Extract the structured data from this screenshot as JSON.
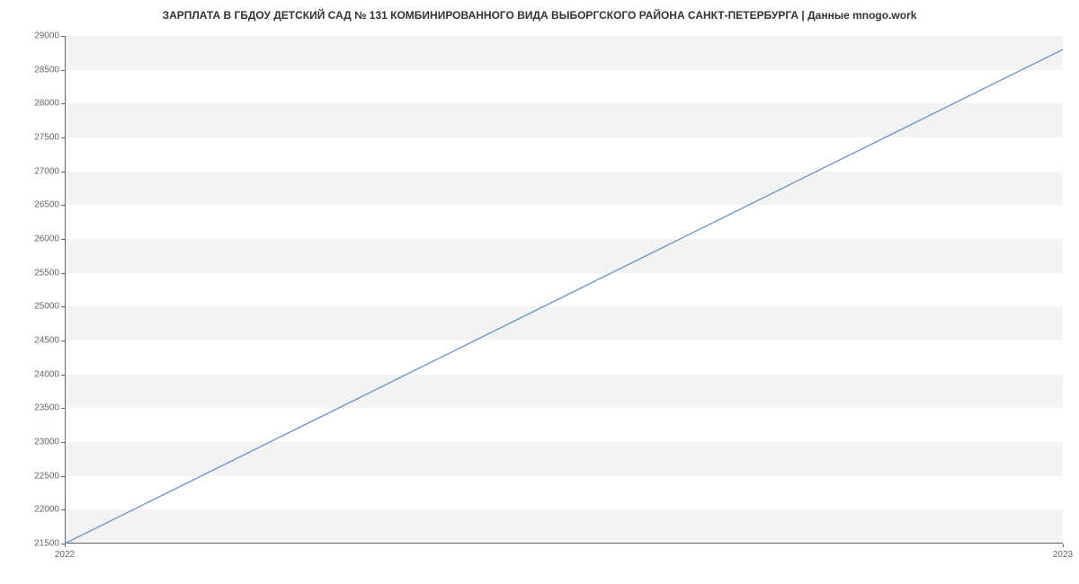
{
  "chart_data": {
    "type": "line",
    "title": "ЗАРПЛАТА В ГБДОУ ДЕТСКИЙ САД № 131 КОМБИНИРОВАННОГО ВИДА ВЫБОРГСКОГО РАЙОНА САНКТ-ПЕТЕРБУРГА | Данные mnogo.work",
    "x": [
      "2022",
      "2023"
    ],
    "values": [
      21500,
      28800
    ],
    "xlabel": "",
    "ylabel": "",
    "ylim": [
      21500,
      29000
    ],
    "y_ticks": [
      21500,
      22000,
      22500,
      23000,
      23500,
      24000,
      24500,
      25000,
      25500,
      26000,
      26500,
      27000,
      27500,
      28000,
      28500,
      29000
    ],
    "x_ticks": [
      "2022",
      "2023"
    ],
    "line_color": "#7297c9"
  }
}
